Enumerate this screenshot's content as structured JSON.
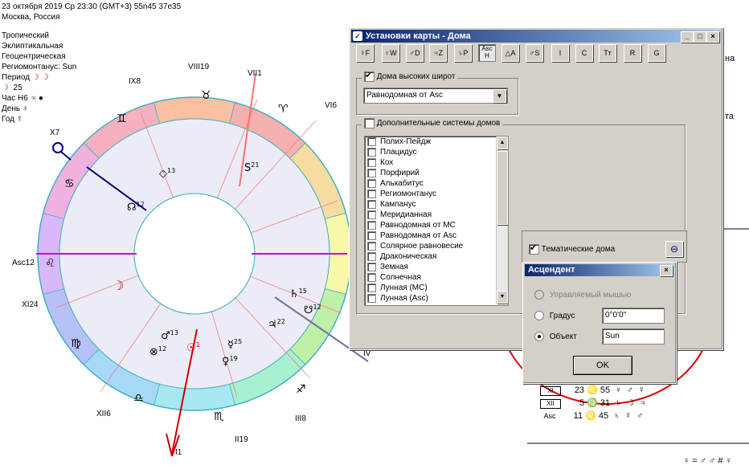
{
  "header": {
    "date_line": "23 октября 2019  Ср  23:30 (GMT+3) 55n45  37e35",
    "place": "Москва, Россия",
    "settings": [
      "Тропический",
      "Эклиптикальная",
      "Геоцентрическая",
      "Региомонтанус: Sun"
    ],
    "period_label": "Период",
    "period_value": "☽ ☽",
    "moon_num": "25",
    "hour_label": "Час Н6",
    "hour_value": "♃ ●",
    "day_label": "День",
    "day_value": "♀",
    "year_label": "Год",
    "year_value": "☿"
  },
  "chart": {
    "house_labels": [
      "VIII19",
      "VII1",
      "VI6",
      "IX8",
      "X7",
      "Asc12",
      "XI24",
      "XII6",
      "I1",
      "II19",
      "III8",
      "IV"
    ],
    "signs": [
      "♉",
      "♈",
      "♊",
      "♋",
      "♌",
      "♍",
      "♎",
      "♏",
      "♐"
    ],
    "planets": [
      {
        "glyph": "☊",
        "deg": "12"
      },
      {
        "glyph": "◇",
        "deg": "13"
      },
      {
        "glyph": "S",
        "deg": "21"
      },
      {
        "glyph": "☽",
        "deg": ""
      },
      {
        "glyph": "♄",
        "deg": "15"
      },
      {
        "glyph": "☋",
        "deg": "12"
      },
      {
        "glyph": "♃",
        "deg": "22"
      },
      {
        "glyph": "♂",
        "deg": "13"
      },
      {
        "glyph": "⊗",
        "deg": "12"
      },
      {
        "glyph": "☉",
        "deg": "1"
      },
      {
        "glyph": "☿",
        "deg": "25"
      },
      {
        "glyph": "♀",
        "deg": "19"
      }
    ],
    "accent_colors": {
      "axis": "#d000d0",
      "sun_line": "#d00000",
      "node_line": "#000080",
      "neptune": "#6060a0"
    }
  },
  "right_fragments": {
    "text_a": "на",
    "text_b": "та"
  },
  "dialog": {
    "title": "Установки карты - Дома",
    "toolbar": [
      "☿F",
      "♀W",
      "♂D",
      "♃Z",
      "♄P",
      "Asc H",
      "△A",
      "♂S",
      "I",
      "C",
      "Tт",
      "R",
      "G"
    ],
    "high_lat_label": "Дома высоких широт",
    "high_lat_checked": true,
    "high_lat_combo": "Равнодомная от Asc",
    "extra_label": "Дополнительные системы домов",
    "extra_checked": false,
    "systems": [
      "Полих-Пейдж",
      "Плацидус",
      "Кох",
      "Порфирий",
      "Алькабитус",
      "Региомонтанус",
      "Кампанус",
      "Меридианная",
      "Равнодомная от MC",
      "Равнодомная от Asc",
      "Солярное равновесие",
      "Драконическая",
      "Земная",
      "Солнечная",
      "Лунная (MC)",
      "Лунная (Asc)"
    ],
    "thematic_label": "Тематические дома",
    "thematic_checked": true,
    "window_buttons": [
      "_",
      "□",
      "×"
    ]
  },
  "subdialog": {
    "title": "Асцендент",
    "close": "×",
    "option_mouse": "Управляемый мышью",
    "option_degree": "Градус",
    "degree_value": "0°0'0\"",
    "option_object": "Объект",
    "object_value": "Sun",
    "ok": "OK"
  },
  "table": [
    {
      "sym": "XI",
      "a": "23",
      "sign": "♌",
      "b": "55",
      "p1": "♀",
      "p2": "♂",
      "p3": "☿"
    },
    {
      "sym": "XII",
      "a": "5",
      "sign": "♍",
      "b": "31",
      "p1": "♄",
      "p2": "☽",
      "p3": "♃"
    },
    {
      "sym": "Asc",
      "a": "11",
      "sign": "♌",
      "b": "45",
      "p1": "♄",
      "p2": "☿",
      "p3": "♂"
    }
  ],
  "footer": "♀ = ♂ ♂ # ♀"
}
